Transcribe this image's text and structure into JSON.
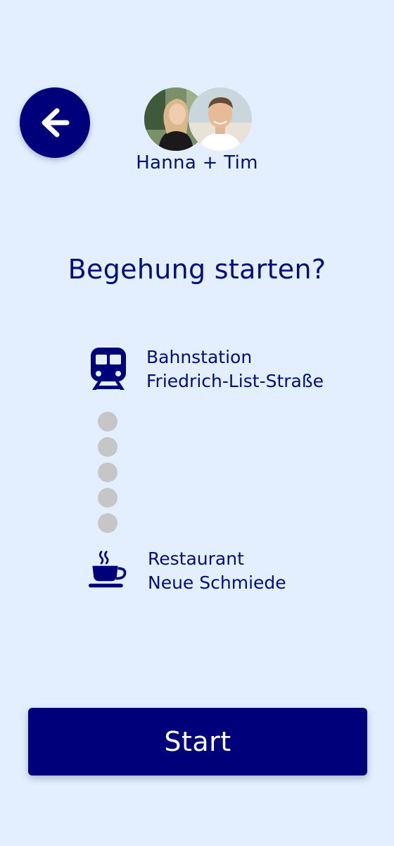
{
  "header": {
    "back_icon": "arrow-left-icon",
    "participants": [
      {
        "name": "Hanna",
        "avatar_icon": "avatar-hanna"
      },
      {
        "name": "Tim",
        "avatar_icon": "avatar-tim"
      }
    ],
    "participants_label": "Hanna + Tim"
  },
  "main": {
    "title": "Begehung starten?",
    "route": {
      "start": {
        "icon": "train-icon",
        "line1": "Bahnstation",
        "line2": "Friedrich-List-Straße"
      },
      "intermediate_dot_count": 5,
      "end": {
        "icon": "coffee-cup-icon",
        "line1": "Restaurant",
        "line2": "Neue Schmiede"
      }
    }
  },
  "footer": {
    "start_label": "Start"
  },
  "colors": {
    "background": "#e3efff",
    "primary": "#00007a",
    "text": "#000f7a",
    "dot": "#c6c6c6",
    "button_text": "#ffffff"
  }
}
